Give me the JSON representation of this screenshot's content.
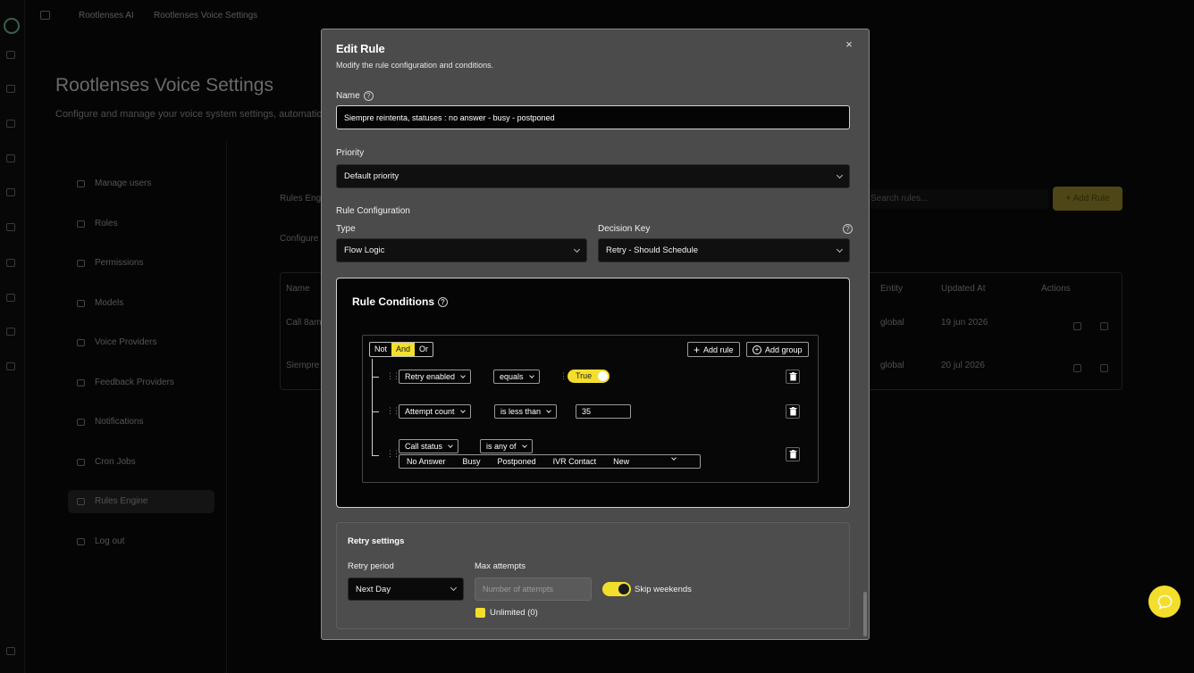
{
  "breadcrumbs": [
    "Rootlenses AI",
    "Rootlenses Voice Settings"
  ],
  "page": {
    "title": "Rootlenses Voice Settings",
    "subtitle": "Configure and manage your voice system settings, automatio"
  },
  "sidebar": {
    "items": [
      {
        "label": "Manage users"
      },
      {
        "label": "Roles"
      },
      {
        "label": "Permissions"
      },
      {
        "label": "Models"
      },
      {
        "label": "Voice Providers"
      },
      {
        "label": "Feedback Providers"
      },
      {
        "label": "Notifications"
      },
      {
        "label": "Cron Jobs"
      },
      {
        "label": "Rules Engine"
      },
      {
        "label": "Log out"
      }
    ]
  },
  "background": {
    "rules_heading": "Rules Eng",
    "configure_text": "Configure",
    "search_placeholder": "Search rules...",
    "add_rule": "+ Add Rule",
    "table_headers": [
      "Name",
      "Entity",
      "Updated At",
      "Actions"
    ],
    "rows": [
      {
        "name": "Call 8am",
        "entity": "global",
        "updated": "19 jun 2026"
      },
      {
        "name": "Siempre",
        "entity": "global",
        "updated": "20 jul 2026"
      }
    ]
  },
  "modal": {
    "title": "Edit Rule",
    "description": "Modify the rule configuration and conditions.",
    "close": "×",
    "name_label": "Name",
    "name_value": "Siempre reintenta, statuses : no answer - busy - postponed",
    "priority_label": "Priority",
    "priority_value": "Default priority",
    "config_label": "Rule Configuration",
    "type_label": "Type",
    "type_value": "Flow Logic",
    "decision_label": "Decision Key",
    "decision_value": "Retry - Should Schedule",
    "conditions_title": "Rule Conditions",
    "combinators": [
      "Not",
      "And",
      "Or"
    ],
    "add_rule": "Add rule",
    "add_group": "Add group",
    "rules": [
      {
        "field": "Retry enabled",
        "operator": "equals",
        "value": "True"
      },
      {
        "field": "Attempt count",
        "operator": "is less than",
        "value": "35"
      },
      {
        "field": "Call status",
        "operator": "is any of",
        "values": [
          "No Answer",
          "Busy",
          "Postponed",
          "IVR Contact",
          "New"
        ]
      }
    ],
    "retry": {
      "title": "Retry settings",
      "period_label": "Retry period",
      "period_value": "Next Day",
      "max_label": "Max attempts",
      "max_placeholder": "Number of attempts",
      "unlimited": "Unlimited (0)",
      "skip_weekends": "Skip weekends"
    }
  },
  "colors": {
    "accent": "#f3df2b",
    "modal_bg": "#4b4b4b",
    "page_bg": "#050505"
  }
}
